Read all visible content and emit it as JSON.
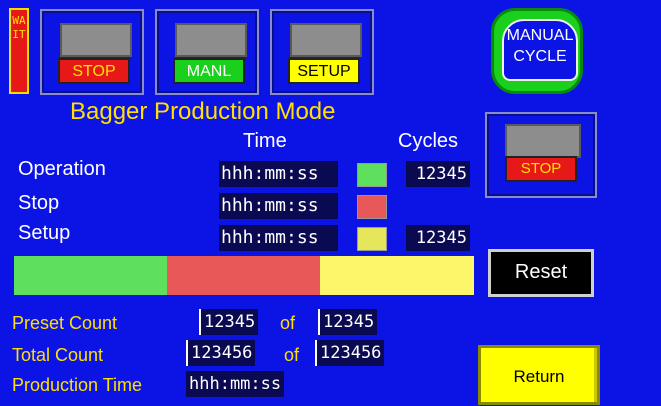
{
  "status": {
    "wait_label": "WAIT",
    "wait_color": "#e61818"
  },
  "mode_buttons": [
    {
      "label": "STOP",
      "color": "#e61818",
      "text_color": "#ffe000"
    },
    {
      "label": "MANL",
      "color": "#19d11c",
      "text_color": "#ffffff"
    },
    {
      "label": "SETUP",
      "color": "#ffff00",
      "text_color": "#000000"
    }
  ],
  "manual_cycle": {
    "line1": "MANUAL",
    "line2": "CYCLE"
  },
  "title": "Bagger Production Mode",
  "headers": {
    "time": "Time",
    "cycles": "Cycles"
  },
  "rows": [
    {
      "label": "Operation",
      "time": "hhh:mm:ss",
      "color": "#5ee05e",
      "cycles": "12345"
    },
    {
      "label": "Stop",
      "time": "hhh:mm:ss",
      "color": "#e85858",
      "cycles": ""
    },
    {
      "label": "Setup",
      "time": "hhh:mm:ss",
      "color": "#e6e65a",
      "cycles": "12345"
    }
  ],
  "right_stop": {
    "label": "STOP"
  },
  "progress_segments": [
    {
      "name": "operation",
      "fraction": 0.333,
      "color": "#5ee05e"
    },
    {
      "name": "stop",
      "fraction": 0.333,
      "color": "#e85858"
    },
    {
      "name": "setup",
      "fraction": 0.334,
      "color": "#fdf66a"
    }
  ],
  "reset_label": "Reset",
  "counts": {
    "preset_label": "Preset Count",
    "preset_value": "12345",
    "preset_of": "of",
    "preset_target": "12345",
    "total_label": "Total Count",
    "total_value": "123456",
    "total_of": "of",
    "total_target": "123456",
    "production_label": "Production Time",
    "production_value": "hhh:mm:ss"
  },
  "return_label": "Return"
}
